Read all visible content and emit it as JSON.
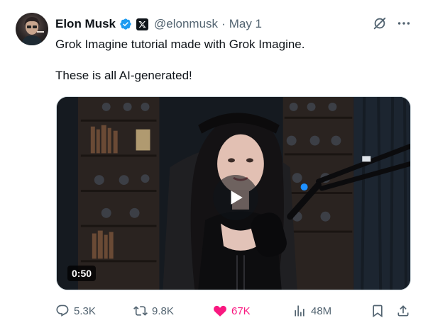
{
  "tweet": {
    "author_name": "Elon Musk",
    "handle": "@elonmusk",
    "separator": "·",
    "date": "May 1",
    "text_line1": "Grok Imagine tutorial made with Grok Imagine.",
    "text_line2": "These is all AI-generated!",
    "video_duration": "0:50"
  },
  "actions": {
    "replies": "5.3K",
    "reposts": "9.8K",
    "likes": "67K",
    "views": "48M"
  },
  "colors": {
    "verified_blue": "#1d9bf0",
    "like_pink": "#f91880",
    "muted_text": "#536471"
  },
  "icons": [
    "verified-badge-icon",
    "x-logo-icon",
    "grok-icon",
    "more-icon",
    "reply-icon",
    "repost-icon",
    "like-icon",
    "views-icon",
    "bookmark-icon",
    "share-icon",
    "play-icon"
  ]
}
